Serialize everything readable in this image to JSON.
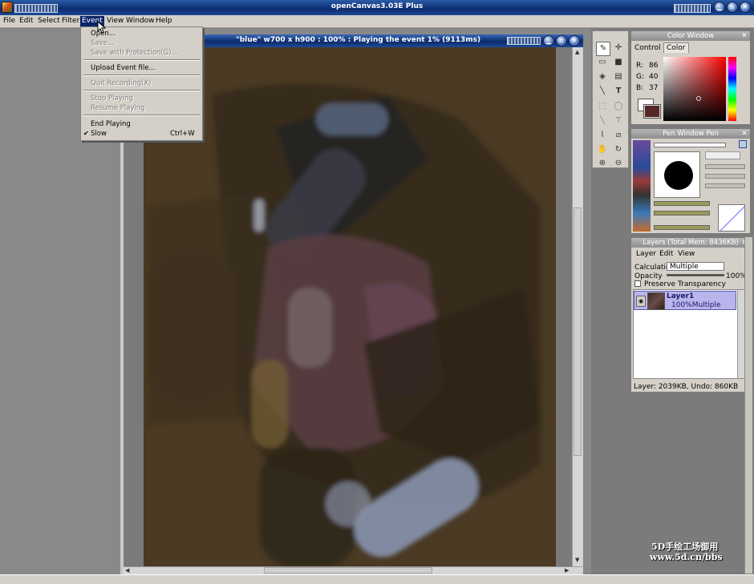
{
  "app": {
    "title": "openCanvas3.03E Plus"
  },
  "menubar": {
    "items": [
      "File",
      "Edit",
      "Select",
      "Filter",
      "Event",
      "View",
      "Window",
      "Help"
    ],
    "active": "Event"
  },
  "event_menu": {
    "open": "Open...",
    "save": "Save...",
    "save_protection": "Save with Protection(G)...",
    "upload": "Upload Event file...",
    "quit_recording": "Quit Recording(X)",
    "stop_playing": "Stop Playing",
    "resume_playing": "Resume Playing",
    "end_playing": "End Playing",
    "slow": "Slow",
    "slow_shortcut": "Ctrl+W",
    "slow_check": "✔"
  },
  "document": {
    "title": "\"blue\" w700 x h900 : 100% : Playing the event 1% (9113ms)"
  },
  "color_window": {
    "title": "Color Window",
    "tabs": [
      "Control",
      "Color"
    ],
    "r_label": "R:",
    "r_value": "86",
    "g_label": "G:",
    "g_value": "40",
    "b_label": "B:",
    "b_value": "37",
    "foreground": "#562825",
    "background": "#ffffff"
  },
  "pen_window": {
    "title": "Pen Window Pen"
  },
  "layers": {
    "title": "Layers (Total Mem: 8436KB)",
    "menu": [
      "Layer",
      "Edit",
      "View"
    ],
    "calc_label": "Calculation",
    "calc_value": "Multiple",
    "opacity_label": "Opacity",
    "opacity_value": "100%",
    "opacity_fraction": 1.0,
    "preserve_label": "Preserve Transparency",
    "layer_name": "Layer1",
    "layer_info": "100%Multiple",
    "status": "Layer: 2039KB, Undo: 860KB"
  },
  "watermark": {
    "line1": "5D手绘工场御用",
    "line2": "www.5d.cn/bbs"
  },
  "colors": {
    "canvas_bg": "#4a3a24",
    "titlebar": "#0b2b6e",
    "menu_highlight": "#0a246a"
  }
}
